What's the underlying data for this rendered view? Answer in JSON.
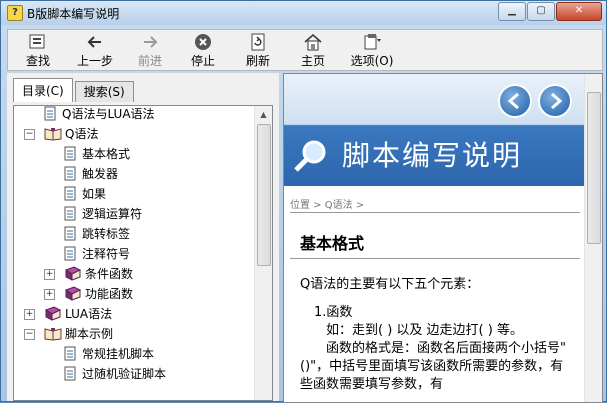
{
  "window": {
    "title": "B版脚本编写说明",
    "app_icon_glyph": "?"
  },
  "toolbar": {
    "items": [
      {
        "label": "查找",
        "icon": "find-icon",
        "enabled": true
      },
      {
        "label": "上一步",
        "icon": "back-arrow-icon",
        "enabled": true
      },
      {
        "label": "前进",
        "icon": "forward-arrow-icon",
        "enabled": false
      },
      {
        "label": "停止",
        "icon": "stop-icon",
        "enabled": true
      },
      {
        "label": "刷新",
        "icon": "refresh-icon",
        "enabled": true
      },
      {
        "label": "主页",
        "icon": "home-icon",
        "enabled": true
      },
      {
        "label": "选项(O)",
        "icon": "options-icon",
        "enabled": true
      }
    ]
  },
  "tabs": [
    {
      "label": "目录(C)",
      "active": true
    },
    {
      "label": "搜索(S)",
      "active": false
    }
  ],
  "tree": [
    {
      "label": "Q语法与LUA语法",
      "type": "page",
      "level": 0,
      "expander": null
    },
    {
      "label": "Q语法",
      "type": "book-open",
      "level": 0,
      "expander": "−"
    },
    {
      "label": "基本格式",
      "type": "page",
      "level": 1,
      "expander": null,
      "selected": true
    },
    {
      "label": "触发器",
      "type": "page",
      "level": 1,
      "expander": null
    },
    {
      "label": "如果",
      "type": "page",
      "level": 1,
      "expander": null
    },
    {
      "label": "逻辑运算符",
      "type": "page",
      "level": 1,
      "expander": null
    },
    {
      "label": "跳转标签",
      "type": "page",
      "level": 1,
      "expander": null
    },
    {
      "label": "注释符号",
      "type": "page",
      "level": 1,
      "expander": null
    },
    {
      "label": "条件函数",
      "type": "book",
      "level": 1,
      "expander": "+"
    },
    {
      "label": "功能函数",
      "type": "book",
      "level": 1,
      "expander": "+"
    },
    {
      "label": "LUA语法",
      "type": "book",
      "level": 0,
      "expander": "+"
    },
    {
      "label": "脚本示例",
      "type": "book-open",
      "level": 0,
      "expander": "−"
    },
    {
      "label": "常规挂机脚本",
      "type": "page",
      "level": 1,
      "expander": null
    },
    {
      "label": "过随机验证脚本",
      "type": "page",
      "level": 1,
      "expander": null
    }
  ],
  "content": {
    "banner_title": "脚本编写说明",
    "breadcrumb": "位置 > Q语法 >",
    "heading": "基本格式",
    "intro": "Q语法的主要有以下五个元素：",
    "item_title": "1.函数",
    "item_line1": "如：走到( ) 以及 边走边打( ) 等。",
    "item_line2": "函数的格式是：函数名后面接两个小括号\"()\"，中括号里面填写该函数所需要的参数，有些函数需要填写参数，有"
  },
  "colors": {
    "banner_blue": "#2d66ad",
    "title_bg": "#c8dbee"
  }
}
